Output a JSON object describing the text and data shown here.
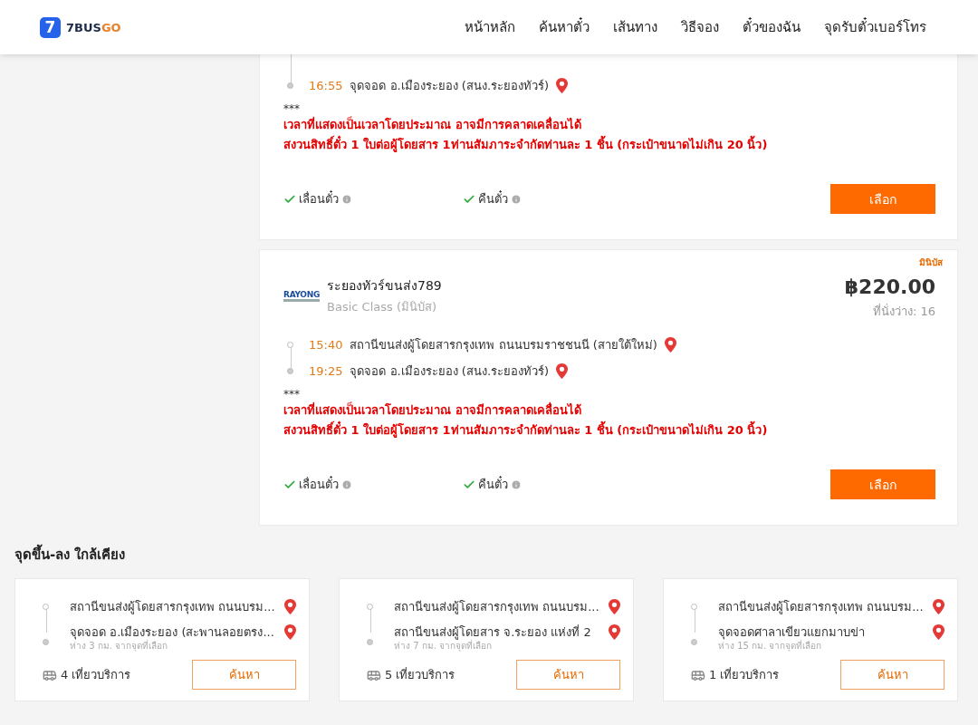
{
  "header": {
    "logo": {
      "mark": "7",
      "name_main": "7BUS",
      "name_accent": "GO"
    },
    "nav": [
      {
        "label": "หน้าหลัก"
      },
      {
        "label": "ค้นหาตั๋ว"
      },
      {
        "label": "เส้นทาง"
      },
      {
        "label": "วิธีจอง"
      },
      {
        "label": "ตั๋วของฉัน"
      },
      {
        "label": "จุดรับตั๋วเบอร์โทร"
      }
    ]
  },
  "trips": [
    {
      "stops": [
        {
          "time": "16:55",
          "place": "จุดจอด อ.เมืองระยอง (สนง.ระยองทัวร์)"
        }
      ],
      "note_mark": "***",
      "notes": [
        "เวลาที่แสดงเป็นเวลาโดยประมาณ อาจมีการคลาดเคลื่อนได้",
        "สงวนสิทธิ์ตั๋ว 1 ใบต่อผู้โดยสาร 1ท่านสัมภาระจำกัดท่านละ 1 ชิ้น (กระเป๋าขนาดไม่เกิน 20 นิ้ว)"
      ],
      "features": [
        "เลื่อนตั๋ว",
        "คืนตั๋ว"
      ],
      "button": "เลือก"
    },
    {
      "badge": "มินิบัส",
      "operator": {
        "logo_text": "RAYONG",
        "name": "ระยองทัวร์ขนส่ง789",
        "class": "Basic Class (มินิบัส)"
      },
      "price": "฿220.00",
      "seats": "ที่นั่งว่าง: 16",
      "stops": [
        {
          "time": "15:40",
          "place": "สถานีขนส่งผู้โดยสารกรุงเทพ ถนนบรมราชชนนี (สายใต้ใหม่)"
        },
        {
          "time": "19:25",
          "place": "จุดจอด อ.เมืองระยอง (สนง.ระยองทัวร์)"
        }
      ],
      "note_mark": "***",
      "notes": [
        "เวลาที่แสดงเป็นเวลาโดยประมาณ อาจมีการคลาดเคลื่อนได้",
        "สงวนสิทธิ์ตั๋ว 1 ใบต่อผู้โดยสาร 1ท่านสัมภาระจำกัดท่านละ 1 ชิ้น (กระเป๋าขนาดไม่เกิน 20 นิ้ว)"
      ],
      "features": [
        "เลื่อนตั๋ว",
        "คืนตั๋ว"
      ],
      "button": "เลือก"
    }
  ],
  "nearby": {
    "title": "จุดขึ้น-ลง ใกล้เคียง",
    "cards": [
      {
        "from": "สถานีขนส่งผู้โดยสารกรุงเทพ ถนนบรม...",
        "to": "จุดจอด อ.เมืองระยอง (สะพานลอยตรง...",
        "distance": "ห่าง 3 กม. จากจุดที่เลือก",
        "trips": "4 เที่ยวบริการ",
        "button": "ค้นหา"
      },
      {
        "from": "สถานีขนส่งผู้โดยสารกรุงเทพ ถนนบรม...",
        "to": "สถานีขนส่งผู้โดยสาร จ.ระยอง แห่งที่ 2",
        "distance": "ห่าง 7 กม. จากจุดที่เลือก",
        "trips": "5 เที่ยวบริการ",
        "button": "ค้นหา"
      },
      {
        "from": "สถานีขนส่งผู้โดยสารกรุงเทพ ถนนบรม...",
        "to": "จุดจอดศาลาเขียวแยกมาบข่า",
        "distance": "ห่าง 15 กม. จากจุดที่เลือก",
        "trips": "1 เที่ยวบริการ",
        "button": "ค้นหา"
      }
    ]
  }
}
